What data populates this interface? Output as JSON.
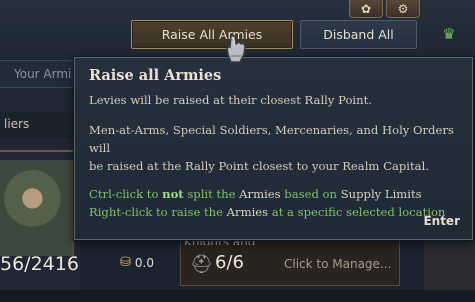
{
  "toolbar": {
    "raise_label": "Raise All Armies",
    "disband_label": "Disband All",
    "icon1": "settings-gear-icon",
    "icon2": "gear-icon",
    "crown_icon": "crown-icon"
  },
  "sidebar": {
    "armies_tab_label": "Your Armi",
    "soldiers_label": "liers"
  },
  "army_summary": {
    "soldier_count": "56/2416",
    "gold_value": "0.0"
  },
  "knights": {
    "title": "Knights and Accolades",
    "count": "6/6",
    "manage_label": "Click to Manage..."
  },
  "tooltip": {
    "title": "Raise all Armies",
    "line1": "Levies will be raised at their closest Rally Point.",
    "line2": "Men-at-Arms, Special Soldiers, Mercenaries, and Holy Orders will",
    "line3": "be raised at the Rally Point closest to your Realm Capital.",
    "ctrl": {
      "a": "Ctrl-click to ",
      "b": "not",
      "c": " split the ",
      "d": "Armies",
      "e": " based on ",
      "f": "Supply Limits"
    },
    "right": {
      "a": "Right-click to raise the ",
      "b": "Armies",
      "c": " at a specific selected location"
    },
    "enter_label": "Enter"
  },
  "colors": {
    "accent_green": "#7fc267",
    "highlight_green": "#9ee084",
    "button_gold_border": "#a6895c"
  }
}
